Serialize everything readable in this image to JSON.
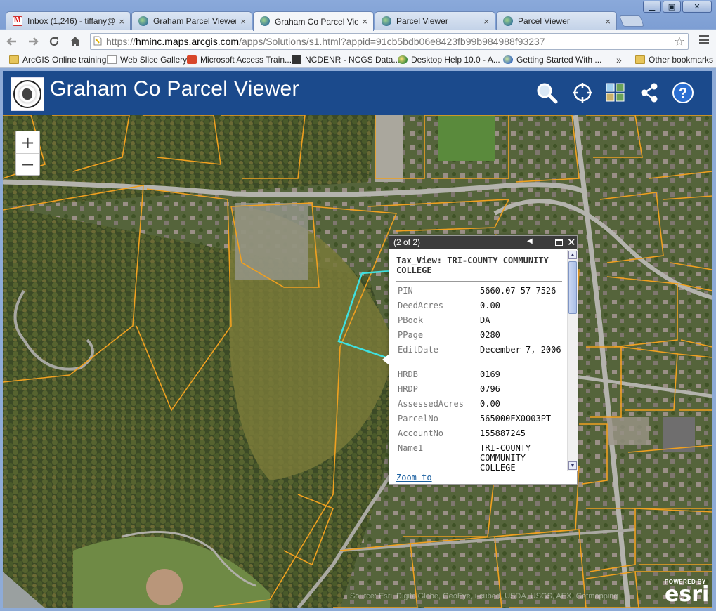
{
  "browser": {
    "tabs": [
      {
        "title": "Inbox (1,246) - tiffany@",
        "icon": "gmail-icon",
        "active": false
      },
      {
        "title": "Graham Parcel Viewer",
        "icon": "globe-icon",
        "active": false
      },
      {
        "title": "Graham Co Parcel Viewer",
        "icon": "globe-icon",
        "active": true
      },
      {
        "title": "Parcel Viewer",
        "icon": "globe-icon",
        "active": false
      },
      {
        "title": "Parcel Viewer",
        "icon": "globe-icon",
        "active": false
      }
    ],
    "tab_close_glyph": "×",
    "window_controls": {
      "minimize": "▁",
      "maximize": "▣",
      "close": "✕"
    },
    "url": {
      "scheme": "https://",
      "host": "hminc.maps.arcgis.com",
      "path": "/apps/Solutions/s1.html?appid=91cb5bdb06e8423fb99b984988f93237"
    },
    "bookmarks": [
      {
        "label": "ArcGIS Online training",
        "icon": "folder-icon"
      },
      {
        "label": "Web Slice Gallery",
        "icon": "page-icon"
      },
      {
        "label": "Microsoft Access Train...",
        "icon": "microsoft-icon"
      },
      {
        "label": "NCDENR - NCGS Data...",
        "icon": "denr-icon"
      },
      {
        "label": "Desktop Help 10.0 - A...",
        "icon": "globe-icon"
      },
      {
        "label": "Getting Started With ...",
        "icon": "ie-icon"
      },
      {
        "label": "Other bookmarks",
        "icon": "folder-icon"
      }
    ],
    "bookmarks_overflow": "»"
  },
  "app": {
    "title": "Graham Co Parcel Viewer",
    "header_color": "#1b4a8c",
    "tools": [
      "search-icon",
      "locate-icon",
      "basemap-gallery-icon",
      "share-icon",
      "help-icon"
    ]
  },
  "map": {
    "zoom_in": "+",
    "zoom_out": "−",
    "parcel_outline_color": "#f0a020",
    "selected_parcel_color": "#3fe0e0",
    "attribution": "Source: Esri, DigitalGlobe, GeoEye, i-cubed, USDA, USGS, AEX, Getmapping",
    "esri_powered": "POWERED BY",
    "esri_word": "esri"
  },
  "popup": {
    "count": "(2 of 2)",
    "prev_glyph": "◀",
    "close_glyph": "✕",
    "title": "Tax_View: TRI-COUNTY COMMUNITY COLLEGE",
    "attributes": [
      {
        "name": "PIN",
        "value": "5660.07-57-7526"
      },
      {
        "name": "DeedAcres",
        "value": "0.00"
      },
      {
        "name": "PBook",
        "value": "DA"
      },
      {
        "name": "PPage",
        "value": "0280"
      },
      {
        "name": "EditDate",
        "value": "December 7, 2006"
      },
      {
        "name": "HRDB",
        "value": "0169"
      },
      {
        "name": "HRDP",
        "value": "0796"
      },
      {
        "name": "AssessedAcres",
        "value": "0.00"
      },
      {
        "name": "ParcelNo",
        "value": "565000EX0003PT"
      },
      {
        "name": "AccountNo",
        "value": "155887245"
      },
      {
        "name": "Name1",
        "value": "TRI-COUNTY COMMUNITY COLLEGE"
      }
    ],
    "zoom_to_label": "Zoom to",
    "scroll_up_glyph": "▲",
    "scroll_down_glyph": "▼"
  }
}
